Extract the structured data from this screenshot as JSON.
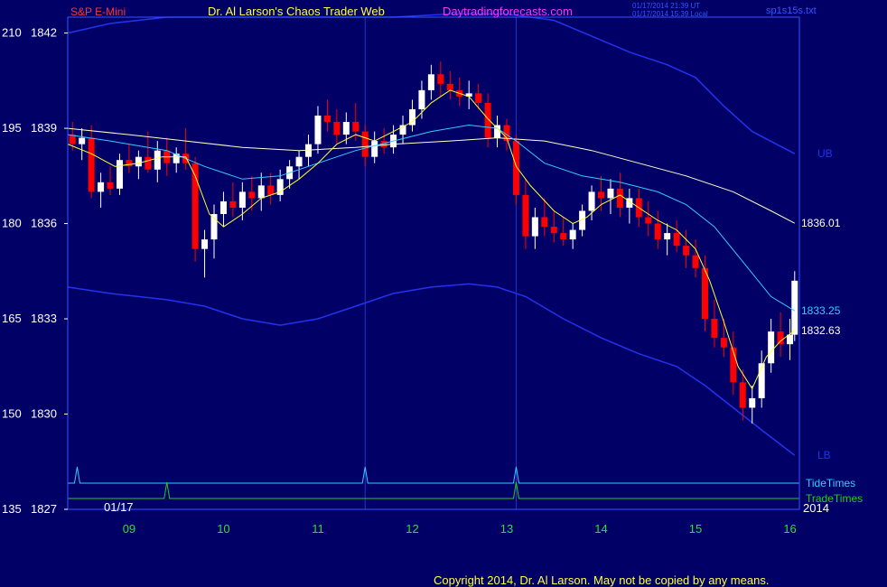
{
  "header": {
    "instrument": "S&P E-Mini",
    "author": "Dr. Al Larson's Chaos Trader Web",
    "website": "Daytradingforecasts.com",
    "timestamp_ut": "01/17/2014 21:39 UT",
    "timestamp_local": "01/17/2014 15:39 Local",
    "filename": "sp1s15s.txt"
  },
  "footer": {
    "copyright": "Copyright 2014, Dr. Al Larson. May not be copied by any means."
  },
  "colors": {
    "background": "#000066",
    "frame": "#3355ff",
    "up_bar": "#ffffff",
    "down_bar": "#ff0000",
    "ema_fast": "#ffff33",
    "ema_mid": "#33ccff",
    "ema_slow": "#ffffcc",
    "bands": "#2233ee",
    "tide_times": "#33ccff",
    "trade_times": "#22cc22",
    "x_labels": "#33dd33"
  },
  "chart_data": {
    "type": "candlestick",
    "title": "S&P E-Mini",
    "ylim": [
      1827,
      1842.5
    ],
    "y_ticks": [
      {
        "left": "210",
        "right": "1842",
        "value": 1842
      },
      {
        "left": "195",
        "right": "1839",
        "value": 1839
      },
      {
        "left": "180",
        "right": "1836",
        "value": 1836
      },
      {
        "left": "165",
        "right": "1833",
        "value": 1833
      },
      {
        "left": "150",
        "right": "1830",
        "value": 1830
      },
      {
        "left": "135",
        "right": "1827",
        "value": 1827
      }
    ],
    "xlim": [
      8.35,
      16.1
    ],
    "x_ticks": [
      "09",
      "10",
      "11",
      "12",
      "13",
      "14",
      "15",
      "16"
    ],
    "x_tick_values": [
      9,
      10,
      11,
      12,
      13,
      14,
      15,
      16
    ],
    "date_label": "01/17",
    "year_label": "2014",
    "vertical_markers": [
      11.5,
      13.1
    ],
    "value_labels": [
      {
        "text": "UB",
        "value": 1838.2,
        "color": "#2233ee"
      },
      {
        "text": "1836.01",
        "value": 1836.01,
        "color": "#ffffff"
      },
      {
        "text": "1833.25",
        "value": 1833.25,
        "color": "#33ccff"
      },
      {
        "text": "1832.63",
        "value": 1832.63,
        "color": "#ffffff"
      },
      {
        "text": "LB",
        "value": 1828.7,
        "color": "#2233ee"
      }
    ],
    "indicators": [
      {
        "name": "TideTimes",
        "color": "#33ccff",
        "spikes": [
          8.45,
          11.5,
          13.1
        ]
      },
      {
        "name": "TradeTimes",
        "color": "#22cc22",
        "spikes": [
          9.4,
          13.1
        ]
      }
    ],
    "lines": {
      "ema_fast": [
        [
          8.35,
          1838.5
        ],
        [
          8.6,
          1838.2
        ],
        [
          8.85,
          1837.8
        ],
        [
          9.1,
          1837.9
        ],
        [
          9.35,
          1838.1
        ],
        [
          9.6,
          1838.1
        ],
        [
          9.7,
          1837.5
        ],
        [
          9.85,
          1836.3
        ],
        [
          10.0,
          1835.9
        ],
        [
          10.2,
          1836.3
        ],
        [
          10.4,
          1836.8
        ],
        [
          10.6,
          1837.0
        ],
        [
          10.8,
          1837.4
        ],
        [
          11.0,
          1837.9
        ],
        [
          11.2,
          1838.5
        ],
        [
          11.4,
          1838.8
        ],
        [
          11.6,
          1838.6
        ],
        [
          11.8,
          1838.9
        ],
        [
          12.0,
          1839.2
        ],
        [
          12.2,
          1839.8
        ],
        [
          12.4,
          1840.2
        ],
        [
          12.6,
          1840.0
        ],
        [
          12.8,
          1839.3
        ],
        [
          13.0,
          1838.7
        ],
        [
          13.1,
          1837.8
        ],
        [
          13.25,
          1837.2
        ],
        [
          13.5,
          1836.4
        ],
        [
          13.7,
          1836.0
        ],
        [
          13.85,
          1836.2
        ],
        [
          14.0,
          1836.6
        ],
        [
          14.2,
          1836.9
        ],
        [
          14.4,
          1836.5
        ],
        [
          14.6,
          1836.1
        ],
        [
          14.8,
          1835.8
        ],
        [
          15.0,
          1835.2
        ],
        [
          15.15,
          1834.2
        ],
        [
          15.3,
          1832.9
        ],
        [
          15.45,
          1831.5
        ],
        [
          15.6,
          1830.8
        ],
        [
          15.75,
          1831.8
        ],
        [
          15.9,
          1832.3
        ],
        [
          16.05,
          1832.63
        ]
      ],
      "ema_mid": [
        [
          8.35,
          1838.8
        ],
        [
          8.8,
          1838.6
        ],
        [
          9.4,
          1838.3
        ],
        [
          9.8,
          1837.8
        ],
        [
          10.2,
          1837.4
        ],
        [
          10.6,
          1837.5
        ],
        [
          11.0,
          1837.9
        ],
        [
          11.4,
          1838.3
        ],
        [
          11.8,
          1838.6
        ],
        [
          12.2,
          1838.9
        ],
        [
          12.6,
          1839.1
        ],
        [
          12.9,
          1839.0
        ],
        [
          13.1,
          1838.6
        ],
        [
          13.4,
          1837.9
        ],
        [
          13.8,
          1837.5
        ],
        [
          14.2,
          1837.3
        ],
        [
          14.6,
          1837.0
        ],
        [
          14.9,
          1836.6
        ],
        [
          15.2,
          1835.9
        ],
        [
          15.5,
          1834.8
        ],
        [
          15.8,
          1833.7
        ],
        [
          16.05,
          1833.25
        ]
      ],
      "ema_slow": [
        [
          8.35,
          1839.0
        ],
        [
          9.0,
          1838.8
        ],
        [
          9.6,
          1838.6
        ],
        [
          10.2,
          1838.4
        ],
        [
          10.8,
          1838.3
        ],
        [
          11.4,
          1838.4
        ],
        [
          11.8,
          1838.5
        ],
        [
          12.4,
          1838.6
        ],
        [
          12.9,
          1838.7
        ],
        [
          13.4,
          1838.6
        ],
        [
          13.9,
          1838.3
        ],
        [
          14.4,
          1837.9
        ],
        [
          14.9,
          1837.5
        ],
        [
          15.4,
          1837.0
        ],
        [
          15.8,
          1836.4
        ],
        [
          16.05,
          1836.01
        ]
      ],
      "band_upper": [
        [
          8.35,
          1842.0
        ],
        [
          8.8,
          1842.3
        ],
        [
          9.4,
          1842.5
        ],
        [
          10.0,
          1842.5
        ],
        [
          10.6,
          1842.5
        ],
        [
          11.2,
          1842.5
        ],
        [
          11.8,
          1842.5
        ],
        [
          12.4,
          1842.6
        ],
        [
          13.0,
          1842.6
        ],
        [
          13.5,
          1842.4
        ],
        [
          13.9,
          1841.9
        ],
        [
          14.3,
          1841.4
        ],
        [
          14.7,
          1841.0
        ],
        [
          15.0,
          1840.6
        ],
        [
          15.3,
          1839.7
        ],
        [
          15.6,
          1838.9
        ],
        [
          16.05,
          1838.2
        ]
      ],
      "band_lower": [
        [
          8.35,
          1834.0
        ],
        [
          8.8,
          1833.8
        ],
        [
          9.4,
          1833.6
        ],
        [
          9.8,
          1833.4
        ],
        [
          10.2,
          1833.0
        ],
        [
          10.6,
          1832.8
        ],
        [
          11.0,
          1833.0
        ],
        [
          11.4,
          1833.4
        ],
        [
          11.8,
          1833.8
        ],
        [
          12.2,
          1834.0
        ],
        [
          12.6,
          1834.1
        ],
        [
          12.9,
          1834.0
        ],
        [
          13.2,
          1833.7
        ],
        [
          13.6,
          1833.0
        ],
        [
          14.0,
          1832.4
        ],
        [
          14.4,
          1831.9
        ],
        [
          14.8,
          1831.5
        ],
        [
          15.1,
          1830.9
        ],
        [
          15.4,
          1830.2
        ],
        [
          15.7,
          1829.5
        ],
        [
          16.05,
          1828.7
        ]
      ]
    },
    "bars": [
      {
        "x": 8.4,
        "o": 1838.8,
        "h": 1839.2,
        "l": 1838.3,
        "c": 1838.5
      },
      {
        "x": 8.5,
        "o": 1838.5,
        "h": 1839.0,
        "l": 1838.0,
        "c": 1838.7
      },
      {
        "x": 8.6,
        "o": 1838.7,
        "h": 1839.1,
        "l": 1836.8,
        "c": 1837.0
      },
      {
        "x": 8.7,
        "o": 1837.0,
        "h": 1837.6,
        "l": 1836.5,
        "c": 1837.3
      },
      {
        "x": 8.8,
        "o": 1837.3,
        "h": 1837.8,
        "l": 1836.9,
        "c": 1837.1
      },
      {
        "x": 8.9,
        "o": 1837.1,
        "h": 1838.2,
        "l": 1836.9,
        "c": 1838.0
      },
      {
        "x": 9.0,
        "o": 1838.0,
        "h": 1838.5,
        "l": 1837.6,
        "c": 1837.8
      },
      {
        "x": 9.1,
        "o": 1837.8,
        "h": 1838.3,
        "l": 1837.4,
        "c": 1838.1
      },
      {
        "x": 9.2,
        "o": 1838.1,
        "h": 1838.9,
        "l": 1837.6,
        "c": 1837.7
      },
      {
        "x": 9.3,
        "o": 1837.7,
        "h": 1838.6,
        "l": 1837.3,
        "c": 1838.3
      },
      {
        "x": 9.4,
        "o": 1838.3,
        "h": 1838.7,
        "l": 1837.5,
        "c": 1837.9
      },
      {
        "x": 9.5,
        "o": 1837.9,
        "h": 1838.4,
        "l": 1837.6,
        "c": 1838.2
      },
      {
        "x": 9.6,
        "o": 1838.2,
        "h": 1839.0,
        "l": 1837.7,
        "c": 1837.9
      },
      {
        "x": 9.7,
        "o": 1837.9,
        "h": 1838.1,
        "l": 1834.8,
        "c": 1835.2
      },
      {
        "x": 9.8,
        "o": 1835.2,
        "h": 1835.8,
        "l": 1834.3,
        "c": 1835.5
      },
      {
        "x": 9.9,
        "o": 1835.5,
        "h": 1836.6,
        "l": 1834.9,
        "c": 1836.3
      },
      {
        "x": 10.0,
        "o": 1836.3,
        "h": 1837.0,
        "l": 1835.9,
        "c": 1836.7
      },
      {
        "x": 10.1,
        "o": 1836.7,
        "h": 1837.3,
        "l": 1836.2,
        "c": 1836.5
      },
      {
        "x": 10.2,
        "o": 1836.5,
        "h": 1837.3,
        "l": 1836.1,
        "c": 1837.0
      },
      {
        "x": 10.3,
        "o": 1837.0,
        "h": 1837.5,
        "l": 1836.4,
        "c": 1836.8
      },
      {
        "x": 10.4,
        "o": 1836.8,
        "h": 1837.6,
        "l": 1836.4,
        "c": 1837.2
      },
      {
        "x": 10.5,
        "o": 1837.2,
        "h": 1837.6,
        "l": 1836.6,
        "c": 1836.9
      },
      {
        "x": 10.6,
        "o": 1836.9,
        "h": 1837.7,
        "l": 1836.7,
        "c": 1837.4
      },
      {
        "x": 10.7,
        "o": 1837.4,
        "h": 1838.0,
        "l": 1837.1,
        "c": 1837.8
      },
      {
        "x": 10.8,
        "o": 1837.8,
        "h": 1838.3,
        "l": 1837.4,
        "c": 1838.1
      },
      {
        "x": 10.9,
        "o": 1838.1,
        "h": 1838.8,
        "l": 1837.8,
        "c": 1838.5
      },
      {
        "x": 11.0,
        "o": 1838.5,
        "h": 1839.7,
        "l": 1838.2,
        "c": 1839.4
      },
      {
        "x": 11.1,
        "o": 1839.4,
        "h": 1839.9,
        "l": 1838.9,
        "c": 1839.2
      },
      {
        "x": 11.2,
        "o": 1839.2,
        "h": 1839.6,
        "l": 1838.5,
        "c": 1838.8
      },
      {
        "x": 11.3,
        "o": 1838.8,
        "h": 1839.5,
        "l": 1838.5,
        "c": 1839.2
      },
      {
        "x": 11.4,
        "o": 1839.2,
        "h": 1839.8,
        "l": 1838.6,
        "c": 1838.9
      },
      {
        "x": 11.5,
        "o": 1838.9,
        "h": 1839.1,
        "l": 1837.8,
        "c": 1838.1
      },
      {
        "x": 11.6,
        "o": 1838.1,
        "h": 1838.9,
        "l": 1837.9,
        "c": 1838.6
      },
      {
        "x": 11.7,
        "o": 1838.6,
        "h": 1839.0,
        "l": 1838.2,
        "c": 1838.4
      },
      {
        "x": 11.8,
        "o": 1838.4,
        "h": 1839.1,
        "l": 1838.2,
        "c": 1838.8
      },
      {
        "x": 11.9,
        "o": 1838.8,
        "h": 1839.4,
        "l": 1838.5,
        "c": 1839.1
      },
      {
        "x": 12.0,
        "o": 1839.1,
        "h": 1839.9,
        "l": 1838.9,
        "c": 1839.6
      },
      {
        "x": 12.1,
        "o": 1839.6,
        "h": 1840.5,
        "l": 1839.3,
        "c": 1840.2
      },
      {
        "x": 12.2,
        "o": 1840.2,
        "h": 1841.0,
        "l": 1839.9,
        "c": 1840.7
      },
      {
        "x": 12.3,
        "o": 1840.7,
        "h": 1841.1,
        "l": 1840.0,
        "c": 1840.4
      },
      {
        "x": 12.4,
        "o": 1840.4,
        "h": 1840.8,
        "l": 1839.9,
        "c": 1840.2
      },
      {
        "x": 12.5,
        "o": 1840.2,
        "h": 1840.6,
        "l": 1839.7,
        "c": 1840.0
      },
      {
        "x": 12.6,
        "o": 1840.0,
        "h": 1840.5,
        "l": 1839.6,
        "c": 1840.1
      },
      {
        "x": 12.7,
        "o": 1840.1,
        "h": 1840.4,
        "l": 1839.6,
        "c": 1839.8
      },
      {
        "x": 12.8,
        "o": 1839.8,
        "h": 1840.1,
        "l": 1838.4,
        "c": 1838.7
      },
      {
        "x": 12.9,
        "o": 1838.7,
        "h": 1839.4,
        "l": 1838.4,
        "c": 1839.1
      },
      {
        "x": 13.0,
        "o": 1839.1,
        "h": 1839.3,
        "l": 1838.3,
        "c": 1838.6
      },
      {
        "x": 13.1,
        "o": 1838.6,
        "h": 1838.8,
        "l": 1836.6,
        "c": 1836.9
      },
      {
        "x": 13.2,
        "o": 1836.9,
        "h": 1837.4,
        "l": 1835.2,
        "c": 1835.6
      },
      {
        "x": 13.3,
        "o": 1835.6,
        "h": 1836.5,
        "l": 1835.2,
        "c": 1836.2
      },
      {
        "x": 13.4,
        "o": 1836.2,
        "h": 1836.8,
        "l": 1835.6,
        "c": 1835.9
      },
      {
        "x": 13.5,
        "o": 1835.9,
        "h": 1836.4,
        "l": 1835.4,
        "c": 1835.7
      },
      {
        "x": 13.6,
        "o": 1835.7,
        "h": 1836.2,
        "l": 1835.3,
        "c": 1835.5
      },
      {
        "x": 13.7,
        "o": 1835.5,
        "h": 1836.0,
        "l": 1835.2,
        "c": 1835.8
      },
      {
        "x": 13.8,
        "o": 1835.8,
        "h": 1836.6,
        "l": 1835.6,
        "c": 1836.4
      },
      {
        "x": 13.9,
        "o": 1836.4,
        "h": 1837.2,
        "l": 1836.1,
        "c": 1837.0
      },
      {
        "x": 14.0,
        "o": 1837.0,
        "h": 1837.5,
        "l": 1836.4,
        "c": 1836.8
      },
      {
        "x": 14.1,
        "o": 1836.8,
        "h": 1837.4,
        "l": 1836.3,
        "c": 1837.1
      },
      {
        "x": 14.2,
        "o": 1837.1,
        "h": 1837.6,
        "l": 1836.2,
        "c": 1836.5
      },
      {
        "x": 14.3,
        "o": 1836.5,
        "h": 1837.1,
        "l": 1836.0,
        "c": 1836.8
      },
      {
        "x": 14.4,
        "o": 1836.8,
        "h": 1837.1,
        "l": 1835.9,
        "c": 1836.2
      },
      {
        "x": 14.5,
        "o": 1836.2,
        "h": 1836.7,
        "l": 1835.6,
        "c": 1836.0
      },
      {
        "x": 14.6,
        "o": 1836.0,
        "h": 1836.4,
        "l": 1835.2,
        "c": 1835.5
      },
      {
        "x": 14.7,
        "o": 1835.5,
        "h": 1836.0,
        "l": 1835.0,
        "c": 1835.7
      },
      {
        "x": 14.8,
        "o": 1835.7,
        "h": 1836.1,
        "l": 1835.1,
        "c": 1835.3
      },
      {
        "x": 14.9,
        "o": 1835.3,
        "h": 1835.8,
        "l": 1834.6,
        "c": 1835.0
      },
      {
        "x": 15.0,
        "o": 1835.0,
        "h": 1835.5,
        "l": 1834.3,
        "c": 1834.6
      },
      {
        "x": 15.1,
        "o": 1834.6,
        "h": 1835.0,
        "l": 1832.6,
        "c": 1833.0
      },
      {
        "x": 15.2,
        "o": 1833.0,
        "h": 1833.6,
        "l": 1832.1,
        "c": 1832.4
      },
      {
        "x": 15.3,
        "o": 1832.4,
        "h": 1833.0,
        "l": 1831.8,
        "c": 1832.1
      },
      {
        "x": 15.4,
        "o": 1832.1,
        "h": 1832.6,
        "l": 1830.6,
        "c": 1831.0
      },
      {
        "x": 15.5,
        "o": 1831.0,
        "h": 1831.4,
        "l": 1829.8,
        "c": 1830.2
      },
      {
        "x": 15.6,
        "o": 1830.2,
        "h": 1830.9,
        "l": 1829.7,
        "c": 1830.5
      },
      {
        "x": 15.7,
        "o": 1830.5,
        "h": 1832.0,
        "l": 1830.2,
        "c": 1831.6
      },
      {
        "x": 15.8,
        "o": 1831.6,
        "h": 1833.0,
        "l": 1831.3,
        "c": 1832.6
      },
      {
        "x": 15.9,
        "o": 1832.6,
        "h": 1833.2,
        "l": 1831.8,
        "c": 1832.2
      },
      {
        "x": 16.0,
        "o": 1832.2,
        "h": 1833.0,
        "l": 1831.7,
        "c": 1832.5
      },
      {
        "x": 16.05,
        "o": 1832.5,
        "h": 1834.5,
        "l": 1832.3,
        "c": 1834.2
      }
    ]
  }
}
